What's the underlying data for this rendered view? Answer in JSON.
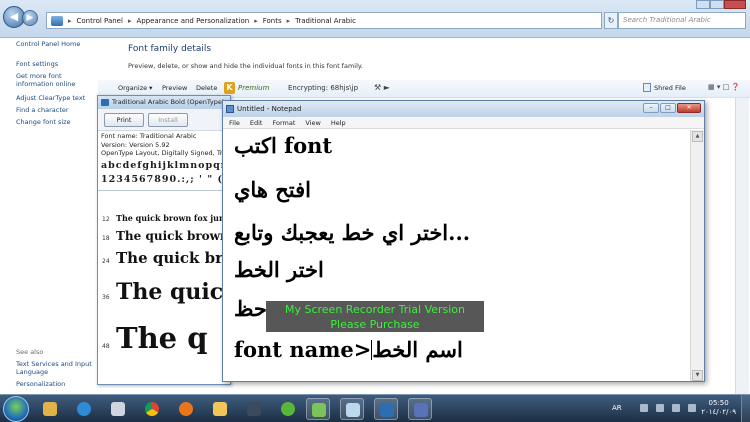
{
  "explorer": {
    "breadcrumbs": [
      "Control Panel",
      "Appearance and Personalization",
      "Fonts",
      "Traditional Arabic"
    ],
    "search_placeholder": "Search Traditional Arabic",
    "left_links": [
      "Control Panel Home",
      "Font settings",
      "Get more font information online",
      "Adjust ClearType text",
      "Find a character",
      "Change font size"
    ],
    "see_also_label": "See also",
    "see_also_links": [
      "Text Services and Input Language",
      "Personalization"
    ],
    "title": "Font family details",
    "description": "Preview, delete, or show and hide the individual fonts in this font family.",
    "toolbar": {
      "organize": "Organize ▾",
      "preview": "Preview",
      "delete": "Delete",
      "premium_label": "Premium",
      "encrypting": "Encrypting:  68hjs\\jp",
      "shred_file": "Shred File"
    }
  },
  "font_preview": {
    "title": "Traditional Arabic Bold (OpenType)",
    "print_label": "Print",
    "install_label": "Install",
    "info_lines": [
      "Font name: Traditional Arabic",
      "Version: Version 5.92",
      "OpenType Layout, Digitally Signed, Tr"
    ],
    "glyph_line_1": "abcdefghijklmnopqrstuvwxyz",
    "glyph_line_2": "1234567890.:,; ' \" (!?) +-*/=",
    "samples": [
      {
        "size": "12",
        "text": "The quick brown fox jumps"
      },
      {
        "size": "18",
        "text": "The quick brown"
      },
      {
        "size": "24",
        "text": "The quick bro"
      },
      {
        "size": "36",
        "text": "The quic"
      },
      {
        "size": "48",
        "text": "The q"
      }
    ]
  },
  "notepad": {
    "title": "Untitled - Notepad",
    "menu": [
      "File",
      "Edit",
      "Format",
      "View",
      "Help"
    ],
    "lines": [
      "اكتب font",
      "افتح هاي",
      "اختر اي خط يعجبك وتابع...",
      "اختر الخط",
      "حظ"
    ],
    "last_line_latin": "font name>",
    "last_line_arabic": "اسم الخط"
  },
  "watermark": {
    "line1": "My Screen Recorder Trial Version",
    "line2": "Please Purchase"
  },
  "taskbar": {
    "language": "AR",
    "time": "05:50",
    "date": "٢٠١٤/٠٢/٠٩"
  },
  "colors": {
    "watermark_text": "#3cf03c",
    "link": "#1a4a82",
    "title_blue": "#1e3c78"
  }
}
